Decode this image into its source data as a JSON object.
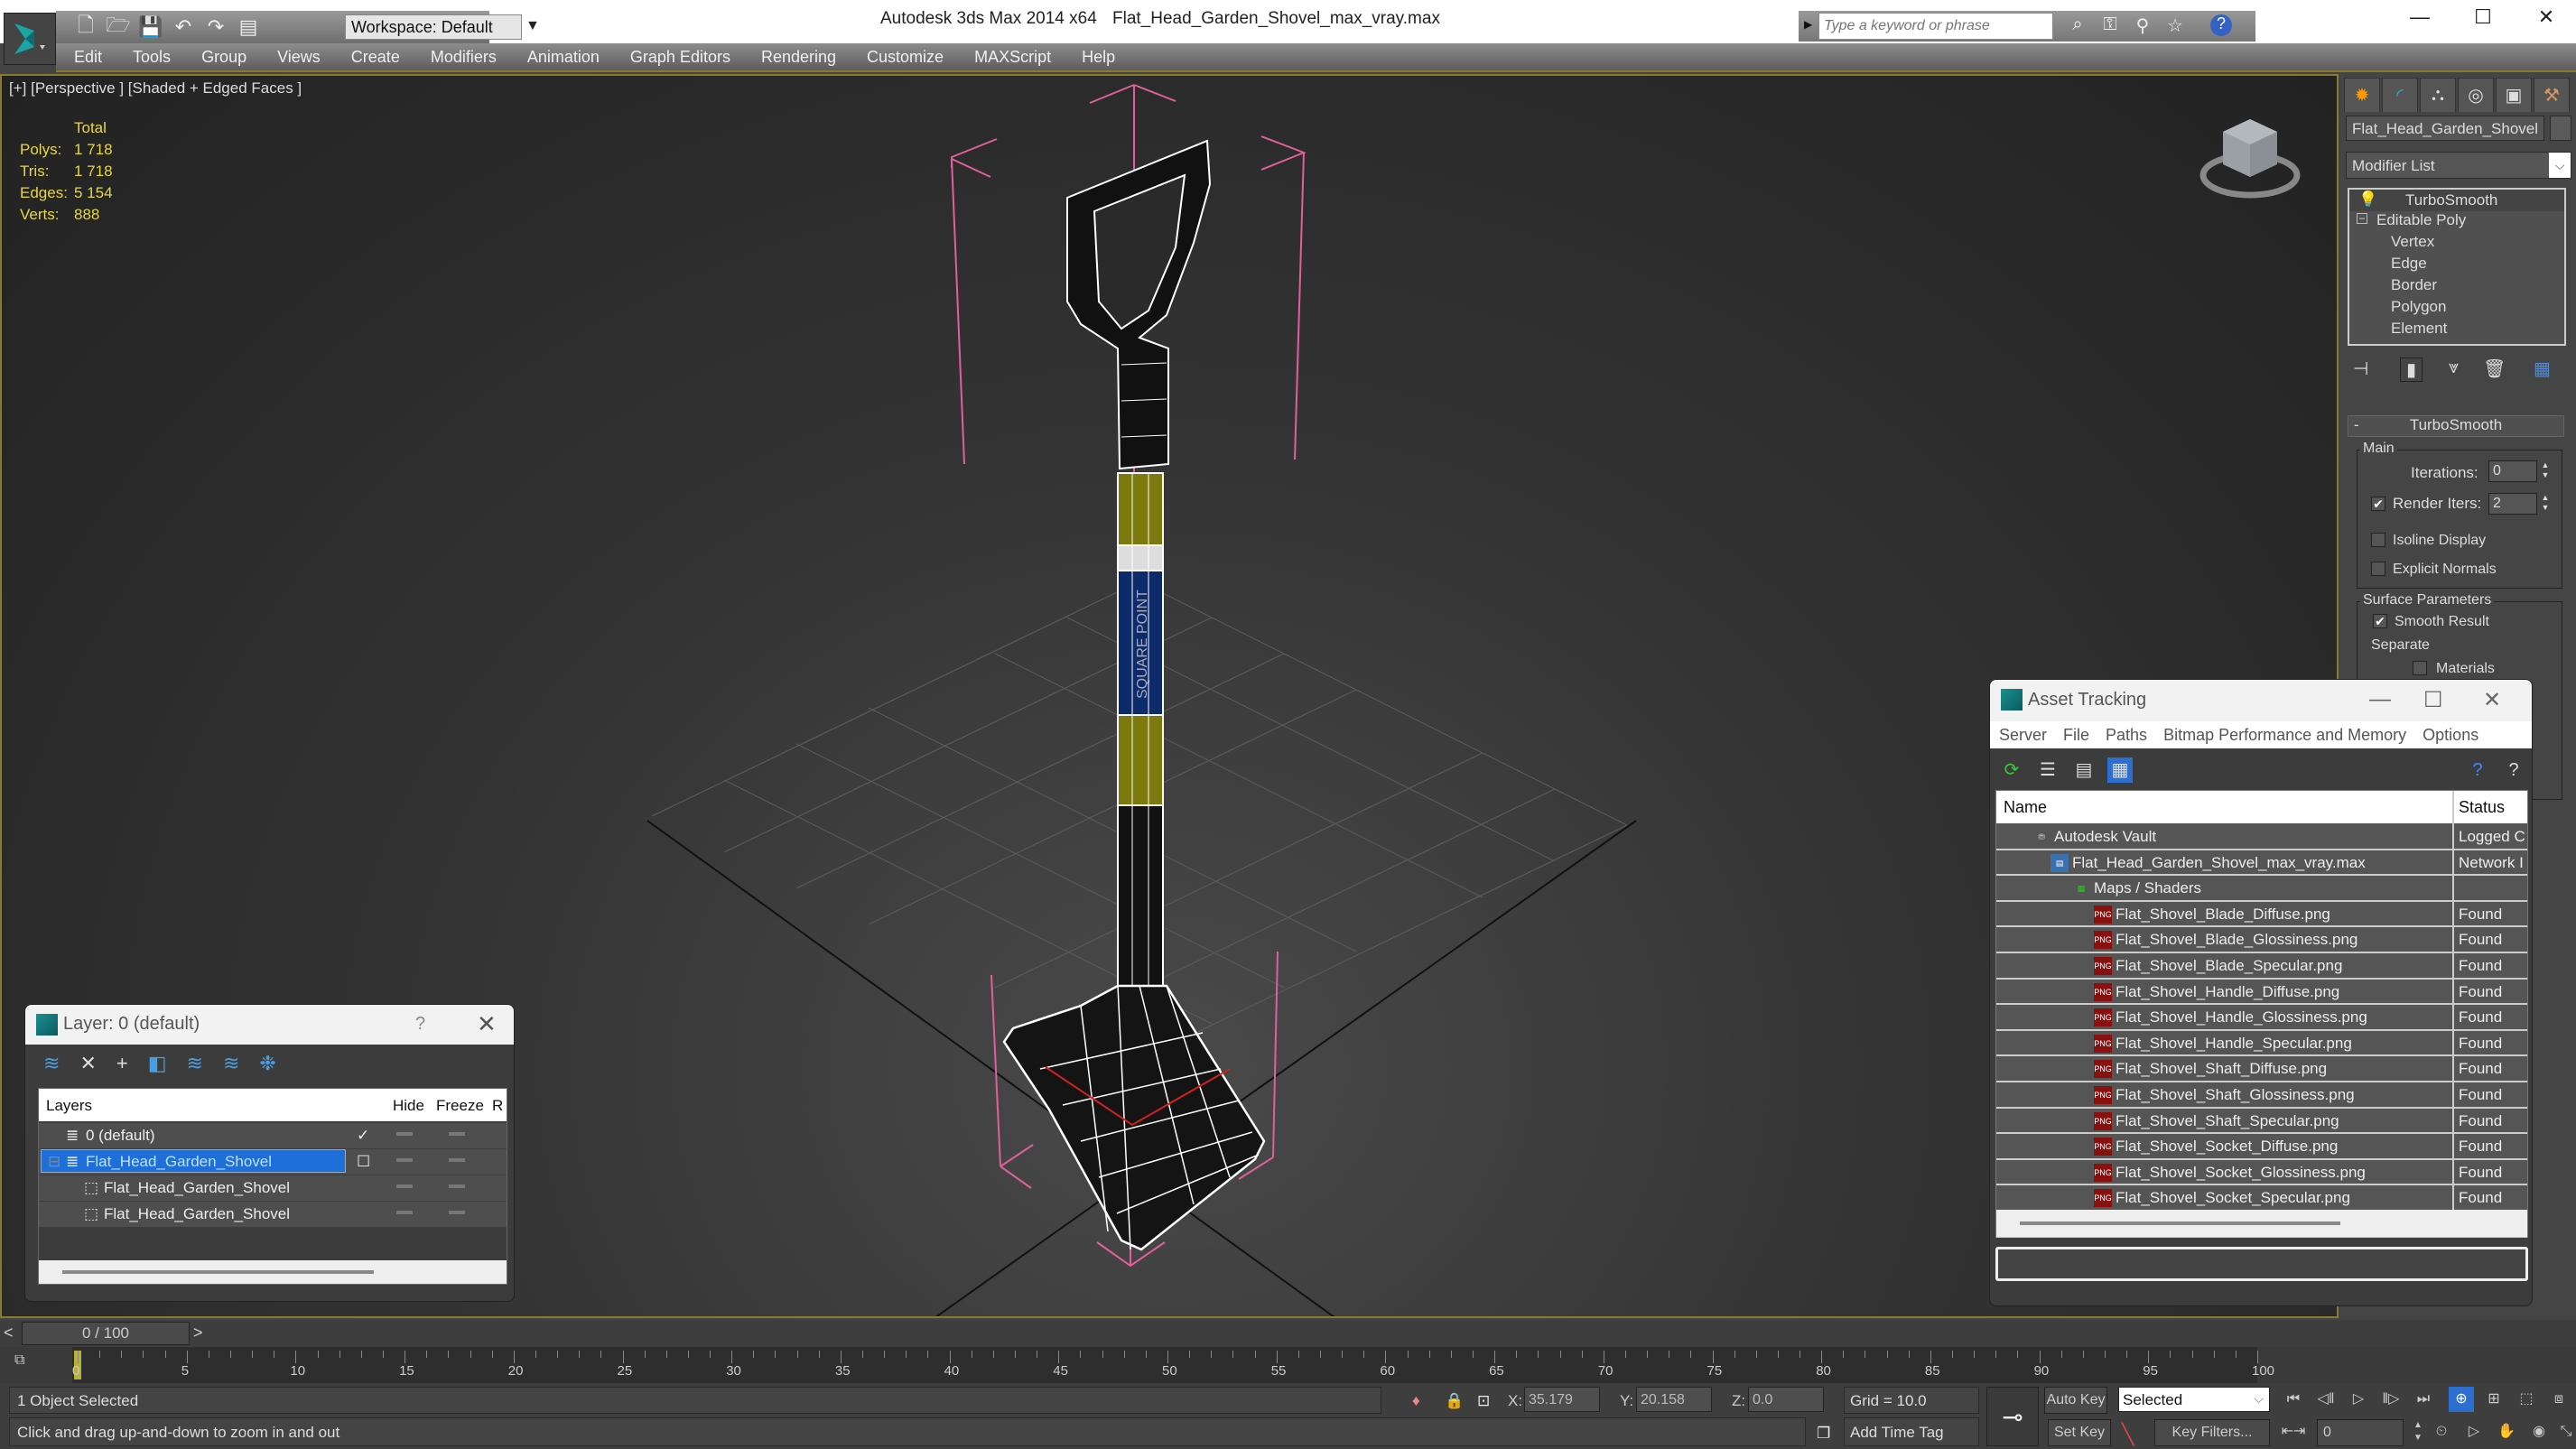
{
  "window": {
    "app_title": "Autodesk 3ds Max  2014 x64",
    "file_title": "Flat_Head_Garden_Shovel_max_vray.max",
    "workspace": "Workspace: Default",
    "search_placeholder": "Type a keyword or phrase",
    "minimize": "—",
    "maximize": "☐",
    "close": "✕"
  },
  "menu": [
    "Edit",
    "Tools",
    "Group",
    "Views",
    "Create",
    "Modifiers",
    "Animation",
    "Graph Editors",
    "Rendering",
    "Customize",
    "MAXScript",
    "Help"
  ],
  "viewport": {
    "label": "[+] [Perspective ] [Shaded + Edged Faces ]",
    "stats": {
      "header": "Total",
      "rows": [
        {
          "key": "Polys:",
          "value": "1 718"
        },
        {
          "key": "Tris:",
          "value": "1 718"
        },
        {
          "key": "Edges:",
          "value": "5 154"
        },
        {
          "key": "Verts:",
          "value": "888"
        }
      ]
    },
    "shaft_label": "SQUARE POINT"
  },
  "command_panel": {
    "object_name": "Flat_Head_Garden_Shovel",
    "modifier_list": "Modifier List",
    "stack": {
      "top": "TurboSmooth",
      "base": "Editable Poly",
      "subobjects": [
        "Vertex",
        "Edge",
        "Border",
        "Polygon",
        "Element"
      ]
    },
    "turbosmooth": {
      "title": "TurboSmooth",
      "collapse": "-",
      "main_group": "Main",
      "iterations_label": "Iterations:",
      "iterations": "0",
      "render_iters_label": "Render Iters:",
      "render_iters": "2",
      "render_iters_checked": true,
      "isoline_label": "Isoline Display",
      "isoline_checked": false,
      "explicit_normals_label": "Explicit Normals",
      "explicit_normals_checked": false,
      "surface_group": "Surface Parameters",
      "smooth_result_label": "Smooth Result",
      "smooth_result_checked": true,
      "separate_label": "Separate",
      "materials_label": "Materials",
      "materials_checked": false
    }
  },
  "layer_dialog": {
    "title": "Layer: 0 (default)",
    "help": "?",
    "close": "✕",
    "columns": [
      "Layers",
      "",
      "Hide",
      "Freeze",
      "R"
    ],
    "rows": [
      {
        "name": "0 (default)",
        "current": "✓",
        "level": 0
      },
      {
        "name": "Flat_Head_Garden_Shovel",
        "current": "☐",
        "level": 0,
        "selected": true
      },
      {
        "name": "Flat_Head_Garden_Shovel",
        "current": "",
        "level": 1
      },
      {
        "name": "Flat_Head_Garden_Shovel",
        "current": "",
        "level": 1
      }
    ]
  },
  "asset_dialog": {
    "title": "Asset Tracking",
    "menu": [
      "Server",
      "File",
      "Paths",
      "Bitmap Performance and Memory",
      "Options"
    ],
    "columns": [
      "Name",
      "Status"
    ],
    "rows": [
      {
        "name": "Autodesk Vault",
        "status": "Logged C",
        "icon": "vault",
        "level": 0
      },
      {
        "name": "Flat_Head_Garden_Shovel_max_vray.max",
        "status": "Network I",
        "icon": "max",
        "level": 1
      },
      {
        "name": "Maps / Shaders",
        "status": "",
        "icon": "maps",
        "level": 2
      },
      {
        "name": "Flat_Shovel_Blade_Diffuse.png",
        "status": "Found",
        "icon": "png",
        "level": 3
      },
      {
        "name": "Flat_Shovel_Blade_Glossiness.png",
        "status": "Found",
        "icon": "png",
        "level": 3
      },
      {
        "name": "Flat_Shovel_Blade_Specular.png",
        "status": "Found",
        "icon": "png",
        "level": 3
      },
      {
        "name": "Flat_Shovel_Handle_Diffuse.png",
        "status": "Found",
        "icon": "png",
        "level": 3
      },
      {
        "name": "Flat_Shovel_Handle_Glossiness.png",
        "status": "Found",
        "icon": "png",
        "level": 3
      },
      {
        "name": "Flat_Shovel_Handle_Specular.png",
        "status": "Found",
        "icon": "png",
        "level": 3
      },
      {
        "name": "Flat_Shovel_Shaft_Diffuse.png",
        "status": "Found",
        "icon": "png",
        "level": 3
      },
      {
        "name": "Flat_Shovel_Shaft_Glossiness.png",
        "status": "Found",
        "icon": "png",
        "level": 3
      },
      {
        "name": "Flat_Shovel_Shaft_Specular.png",
        "status": "Found",
        "icon": "png",
        "level": 3
      },
      {
        "name": "Flat_Shovel_Socket_Diffuse.png",
        "status": "Found",
        "icon": "png",
        "level": 3
      },
      {
        "name": "Flat_Shovel_Socket_Glossiness.png",
        "status": "Found",
        "icon": "png",
        "level": 3
      },
      {
        "name": "Flat_Shovel_Socket_Specular.png",
        "status": "Found",
        "icon": "png",
        "level": 3
      }
    ]
  },
  "timeline": {
    "slider": "0 / 100",
    "prev": "<",
    "next": ">",
    "ticks": [
      0,
      5,
      10,
      15,
      20,
      25,
      30,
      35,
      40,
      45,
      50,
      55,
      60,
      65,
      70,
      75,
      80,
      85,
      90,
      95,
      100
    ],
    "current_frame": 0,
    "max_frame": 100
  },
  "status": {
    "selection": "1 Object Selected",
    "prompt": "Click and drag up-and-down to zoom in and out",
    "x_label": "X:",
    "x": "35.179",
    "y_label": "Y:",
    "y": "20.158",
    "z_label": "Z:",
    "z": "0.0",
    "grid": "Grid = 10.0",
    "add_time_tag": "Add Time Tag",
    "auto_key": "Auto Key",
    "set_key": "Set Key",
    "key_mode": "Selected",
    "key_filters": "Key Filters...",
    "frame": "0"
  },
  "colors": {
    "accent_selection": "#1e6fd9",
    "stats_yellow": "#e8d640",
    "bbox_pink": "#e0609a",
    "viewport_border": "#8a7a30"
  }
}
